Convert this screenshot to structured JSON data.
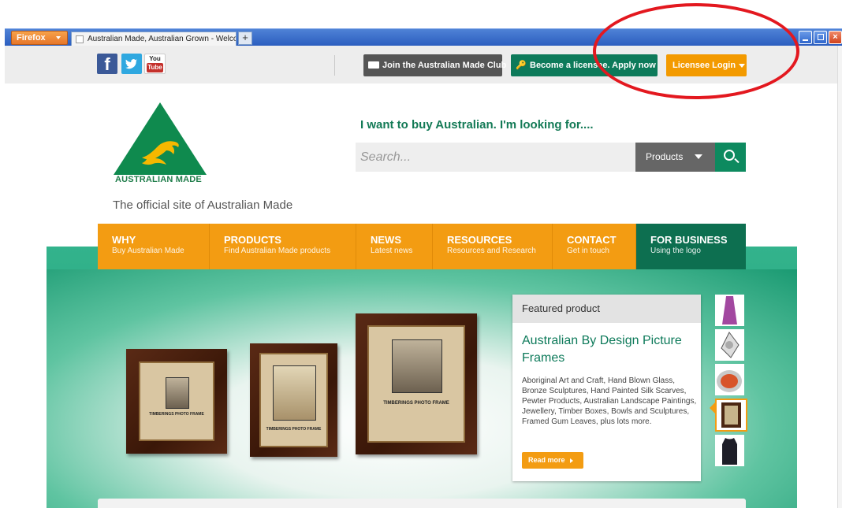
{
  "browser": {
    "menu_label": "Firefox",
    "tab_title": "Australian Made, Australian Grown - Welcom...",
    "new_tab_label": "+"
  },
  "topbar": {
    "social": {
      "facebook": "f",
      "youtube_you": "You",
      "youtube_tube": "Tube"
    },
    "join_label": "Join the Australian Made Club",
    "licensee_label": "Become a licensee. Apply now",
    "login_label": "Licensee Login"
  },
  "header": {
    "logo_text": "AUSTRALIAN MADE",
    "tagline": "The official site of Australian Made",
    "search_heading": "I want to buy Australian. I'm looking for....",
    "search_placeholder": "Search...",
    "search_category": "Products"
  },
  "nav": [
    {
      "title": "WHY",
      "subtitle": "Buy Australian Made"
    },
    {
      "title": "PRODUCTS",
      "subtitle": "Find Australian Made products"
    },
    {
      "title": "NEWS",
      "subtitle": "Latest news"
    },
    {
      "title": "RESOURCES",
      "subtitle": "Resources and Research"
    },
    {
      "title": "CONTACT",
      "subtitle": "Get in touch"
    },
    {
      "title": "FOR BUSINESS",
      "subtitle": "Using the logo"
    }
  ],
  "featured": {
    "heading": "Featured product",
    "title": "Australian By Design Picture Frames",
    "description": "Aboriginal Art and Craft, Hand Blown Glass, Bronze Sculptures, Hand Painted Silk Scarves, Pewter Products, Australian Landscape Paintings, Jewellery, Timber Boxes, Bowls and Sculptures, Framed Gum Leaves, plus lots more.",
    "read_more": "Read more",
    "frame_label": "TIMBERINGS PHOTO FRAME"
  },
  "colors": {
    "brand_green": "#0d7a5a",
    "brand_orange": "#f39c12",
    "annotation_red": "#e3181f"
  }
}
